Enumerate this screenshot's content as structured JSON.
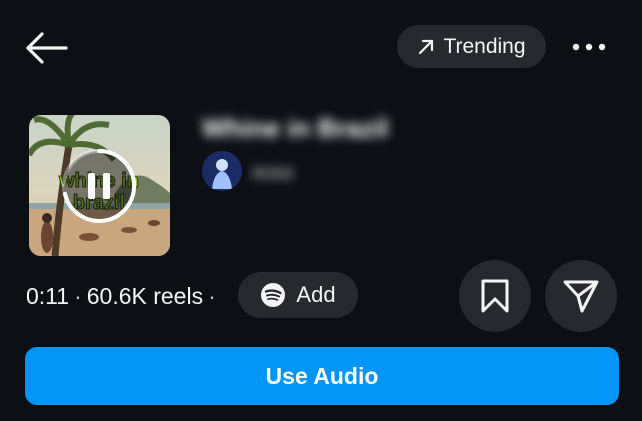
{
  "header": {
    "back_icon": "arrow-left-icon",
    "trending_label": "Trending",
    "trending_icon": "arrow-up-right-icon",
    "more_icon": "more-horizontal-icon"
  },
  "track": {
    "title": "Whine in Brazil",
    "artist": "Artist",
    "art_icon": "album-art",
    "art_text": "whine in brazil",
    "play_state_icon": "pause-icon"
  },
  "meta": {
    "duration": "0:11",
    "reels": "60.6K reels",
    "separator": "·"
  },
  "actions": {
    "add_label": "Add",
    "add_icon": "spotify-icon",
    "save_icon": "bookmark-icon",
    "share_icon": "send-icon",
    "use_audio_label": "Use Audio"
  },
  "colors": {
    "background": "#0c1014",
    "pill": "#262a2f",
    "primary": "#0095f6",
    "text": "#f5f5f5"
  }
}
